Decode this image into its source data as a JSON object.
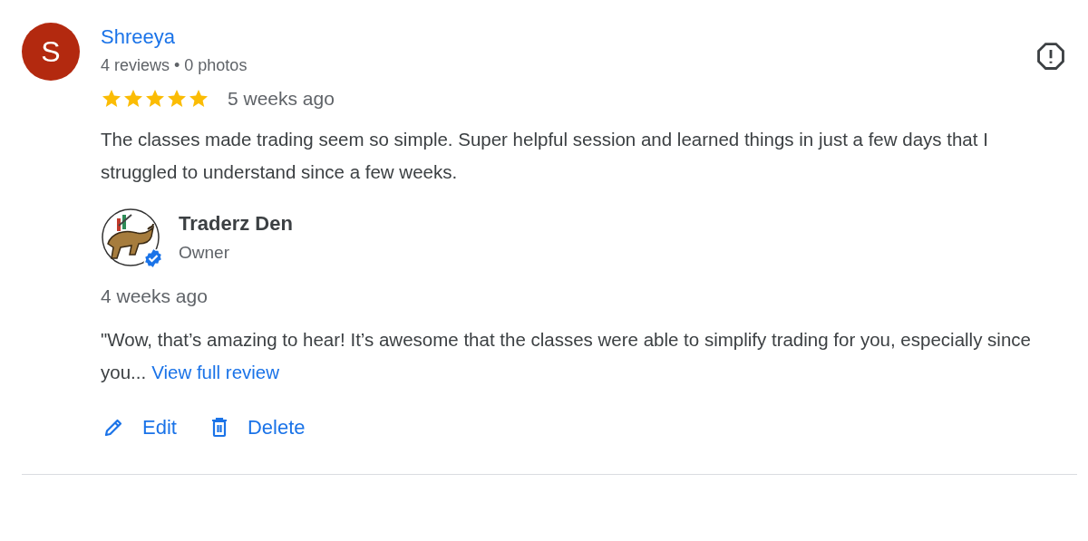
{
  "review": {
    "avatar_letter": "S",
    "author": "Shreeya",
    "author_meta": "4 reviews • 0 photos",
    "stars": 5,
    "time": "5 weeks ago",
    "text": "The classes made trading seem so simple. Super helpful session and learned things in just a few days that I struggled to understand since a few weeks."
  },
  "reply": {
    "name": "Traderz Den",
    "role": "Owner",
    "verified": true,
    "time": "4 weeks ago",
    "text": "\"Wow, that’s amazing to hear! It’s awesome that the classes were able to simplify trading for you, especially since you...",
    "link": "View full review"
  },
  "actions": [
    {
      "kind": "edit",
      "label": "Edit"
    },
    {
      "kind": "delete",
      "label": "Delete"
    }
  ]
}
